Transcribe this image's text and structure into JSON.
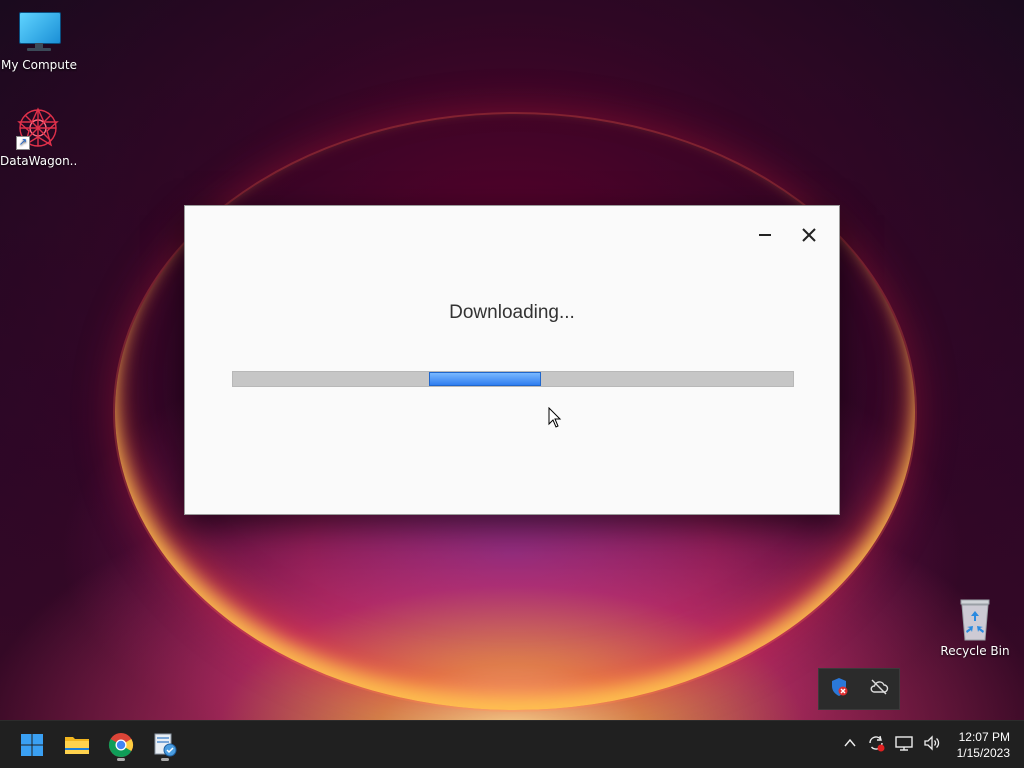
{
  "desktop": {
    "icons": [
      {
        "label": "My Computer",
        "icon": "monitor-icon"
      },
      {
        "label": "DataWagon...",
        "icon": "datawagon-app-icon"
      },
      {
        "label": "Recycle Bin",
        "icon": "recycle-bin-icon"
      }
    ]
  },
  "download_window": {
    "title": "Downloading...",
    "progress_fraction_start": 0.35,
    "progress_fraction_end": 0.55,
    "progress_color": "#2f7ef0",
    "minimize_icon": "minimize-icon",
    "close_icon": "close-icon"
  },
  "tray_popup": {
    "icons": [
      "security-shield-icon",
      "cloud-offline-icon"
    ]
  },
  "taskbar": {
    "apps": [
      "start-windows-icon",
      "file-explorer-icon",
      "chrome-icon",
      "installer-app-icon"
    ],
    "tray": [
      "chevron-up-icon",
      "sync-icon",
      "network-icon",
      "volume-icon"
    ],
    "time": "12:07 PM",
    "date": "1/15/2023"
  }
}
